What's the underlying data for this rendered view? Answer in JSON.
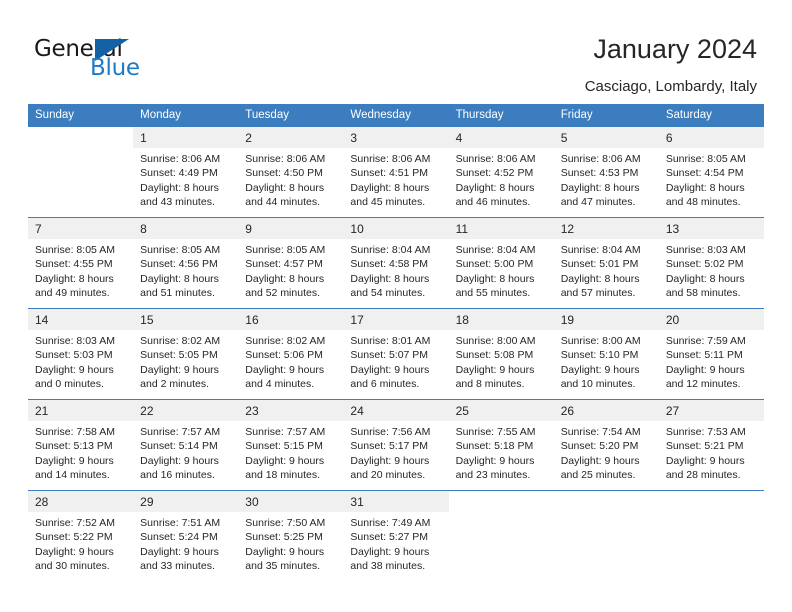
{
  "brand": {
    "name_top": "General",
    "name_bottom": "Blue",
    "accent_color": "#1f7ac4",
    "triangle_color": "#1461a6"
  },
  "header": {
    "title": "January 2024",
    "subtitle": "Casciago, Lombardy, Italy",
    "header_bg": "#3b7dbf",
    "daynum_bg": "#f0f0f0"
  },
  "weekday_headers": [
    "Sunday",
    "Monday",
    "Tuesday",
    "Wednesday",
    "Thursday",
    "Friday",
    "Saturday"
  ],
  "labels": {
    "sunrise_prefix": "Sunrise:",
    "sunset_prefix": "Sunset:",
    "daylight_prefix": "Daylight:"
  },
  "weeks": [
    [
      {
        "day": "",
        "blank": true,
        "l1": "",
        "l2": "",
        "l3": "",
        "l4": ""
      },
      {
        "day": "1",
        "l1": "Sunrise: 8:06 AM",
        "l2": "Sunset: 4:49 PM",
        "l3": "Daylight: 8 hours",
        "l4": "and 43 minutes."
      },
      {
        "day": "2",
        "l1": "Sunrise: 8:06 AM",
        "l2": "Sunset: 4:50 PM",
        "l3": "Daylight: 8 hours",
        "l4": "and 44 minutes."
      },
      {
        "day": "3",
        "l1": "Sunrise: 8:06 AM",
        "l2": "Sunset: 4:51 PM",
        "l3": "Daylight: 8 hours",
        "l4": "and 45 minutes."
      },
      {
        "day": "4",
        "l1": "Sunrise: 8:06 AM",
        "l2": "Sunset: 4:52 PM",
        "l3": "Daylight: 8 hours",
        "l4": "and 46 minutes."
      },
      {
        "day": "5",
        "l1": "Sunrise: 8:06 AM",
        "l2": "Sunset: 4:53 PM",
        "l3": "Daylight: 8 hours",
        "l4": "and 47 minutes."
      },
      {
        "day": "6",
        "l1": "Sunrise: 8:05 AM",
        "l2": "Sunset: 4:54 PM",
        "l3": "Daylight: 8 hours",
        "l4": "and 48 minutes."
      }
    ],
    [
      {
        "day": "7",
        "l1": "Sunrise: 8:05 AM",
        "l2": "Sunset: 4:55 PM",
        "l3": "Daylight: 8 hours",
        "l4": "and 49 minutes."
      },
      {
        "day": "8",
        "l1": "Sunrise: 8:05 AM",
        "l2": "Sunset: 4:56 PM",
        "l3": "Daylight: 8 hours",
        "l4": "and 51 minutes."
      },
      {
        "day": "9",
        "l1": "Sunrise: 8:05 AM",
        "l2": "Sunset: 4:57 PM",
        "l3": "Daylight: 8 hours",
        "l4": "and 52 minutes."
      },
      {
        "day": "10",
        "l1": "Sunrise: 8:04 AM",
        "l2": "Sunset: 4:58 PM",
        "l3": "Daylight: 8 hours",
        "l4": "and 54 minutes."
      },
      {
        "day": "11",
        "l1": "Sunrise: 8:04 AM",
        "l2": "Sunset: 5:00 PM",
        "l3": "Daylight: 8 hours",
        "l4": "and 55 minutes."
      },
      {
        "day": "12",
        "l1": "Sunrise: 8:04 AM",
        "l2": "Sunset: 5:01 PM",
        "l3": "Daylight: 8 hours",
        "l4": "and 57 minutes."
      },
      {
        "day": "13",
        "l1": "Sunrise: 8:03 AM",
        "l2": "Sunset: 5:02 PM",
        "l3": "Daylight: 8 hours",
        "l4": "and 58 minutes."
      }
    ],
    [
      {
        "day": "14",
        "l1": "Sunrise: 8:03 AM",
        "l2": "Sunset: 5:03 PM",
        "l3": "Daylight: 9 hours",
        "l4": "and 0 minutes."
      },
      {
        "day": "15",
        "l1": "Sunrise: 8:02 AM",
        "l2": "Sunset: 5:05 PM",
        "l3": "Daylight: 9 hours",
        "l4": "and 2 minutes."
      },
      {
        "day": "16",
        "l1": "Sunrise: 8:02 AM",
        "l2": "Sunset: 5:06 PM",
        "l3": "Daylight: 9 hours",
        "l4": "and 4 minutes."
      },
      {
        "day": "17",
        "l1": "Sunrise: 8:01 AM",
        "l2": "Sunset: 5:07 PM",
        "l3": "Daylight: 9 hours",
        "l4": "and 6 minutes."
      },
      {
        "day": "18",
        "l1": "Sunrise: 8:00 AM",
        "l2": "Sunset: 5:08 PM",
        "l3": "Daylight: 9 hours",
        "l4": "and 8 minutes."
      },
      {
        "day": "19",
        "l1": "Sunrise: 8:00 AM",
        "l2": "Sunset: 5:10 PM",
        "l3": "Daylight: 9 hours",
        "l4": "and 10 minutes."
      },
      {
        "day": "20",
        "l1": "Sunrise: 7:59 AM",
        "l2": "Sunset: 5:11 PM",
        "l3": "Daylight: 9 hours",
        "l4": "and 12 minutes."
      }
    ],
    [
      {
        "day": "21",
        "l1": "Sunrise: 7:58 AM",
        "l2": "Sunset: 5:13 PM",
        "l3": "Daylight: 9 hours",
        "l4": "and 14 minutes."
      },
      {
        "day": "22",
        "l1": "Sunrise: 7:57 AM",
        "l2": "Sunset: 5:14 PM",
        "l3": "Daylight: 9 hours",
        "l4": "and 16 minutes."
      },
      {
        "day": "23",
        "l1": "Sunrise: 7:57 AM",
        "l2": "Sunset: 5:15 PM",
        "l3": "Daylight: 9 hours",
        "l4": "and 18 minutes."
      },
      {
        "day": "24",
        "l1": "Sunrise: 7:56 AM",
        "l2": "Sunset: 5:17 PM",
        "l3": "Daylight: 9 hours",
        "l4": "and 20 minutes."
      },
      {
        "day": "25",
        "l1": "Sunrise: 7:55 AM",
        "l2": "Sunset: 5:18 PM",
        "l3": "Daylight: 9 hours",
        "l4": "and 23 minutes."
      },
      {
        "day": "26",
        "l1": "Sunrise: 7:54 AM",
        "l2": "Sunset: 5:20 PM",
        "l3": "Daylight: 9 hours",
        "l4": "and 25 minutes."
      },
      {
        "day": "27",
        "l1": "Sunrise: 7:53 AM",
        "l2": "Sunset: 5:21 PM",
        "l3": "Daylight: 9 hours",
        "l4": "and 28 minutes."
      }
    ],
    [
      {
        "day": "28",
        "l1": "Sunrise: 7:52 AM",
        "l2": "Sunset: 5:22 PM",
        "l3": "Daylight: 9 hours",
        "l4": "and 30 minutes."
      },
      {
        "day": "29",
        "l1": "Sunrise: 7:51 AM",
        "l2": "Sunset: 5:24 PM",
        "l3": "Daylight: 9 hours",
        "l4": "and 33 minutes."
      },
      {
        "day": "30",
        "l1": "Sunrise: 7:50 AM",
        "l2": "Sunset: 5:25 PM",
        "l3": "Daylight: 9 hours",
        "l4": "and 35 minutes."
      },
      {
        "day": "31",
        "l1": "Sunrise: 7:49 AM",
        "l2": "Sunset: 5:27 PM",
        "l3": "Daylight: 9 hours",
        "l4": "and 38 minutes."
      },
      {
        "day": "",
        "blank": true,
        "l1": "",
        "l2": "",
        "l3": "",
        "l4": ""
      },
      {
        "day": "",
        "blank": true,
        "l1": "",
        "l2": "",
        "l3": "",
        "l4": ""
      },
      {
        "day": "",
        "blank": true,
        "l1": "",
        "l2": "",
        "l3": "",
        "l4": ""
      }
    ]
  ]
}
